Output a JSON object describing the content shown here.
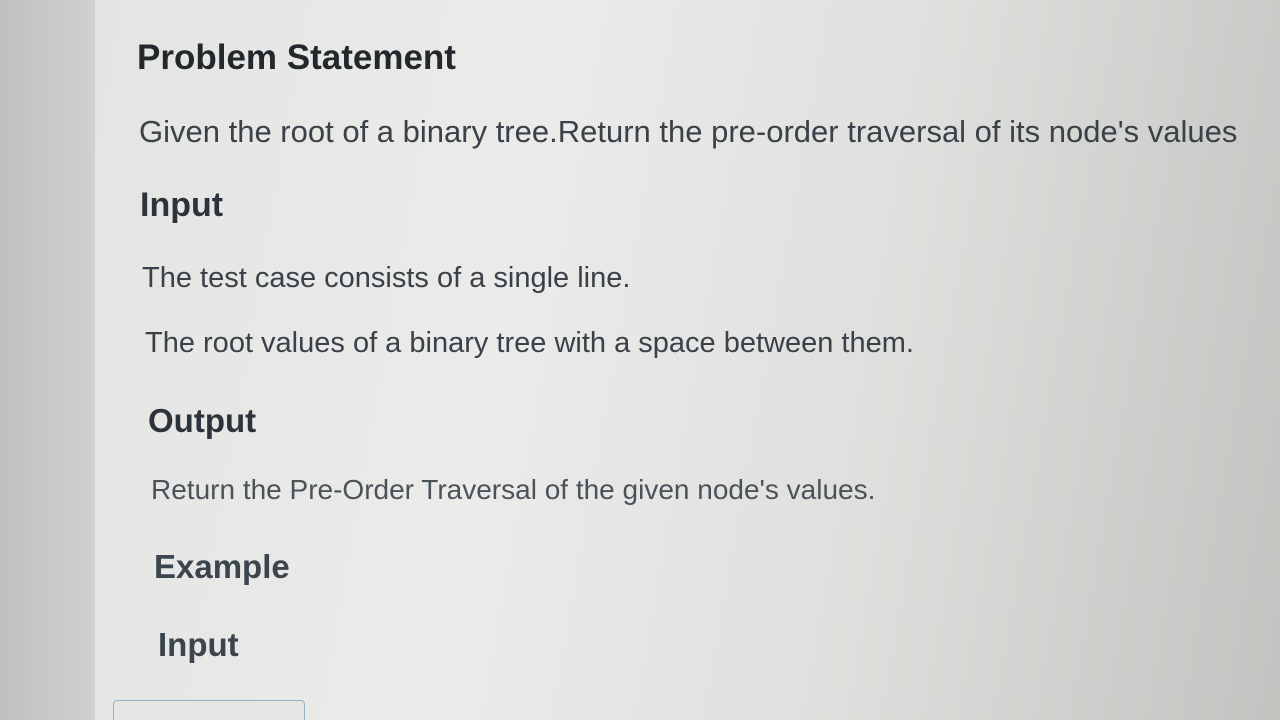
{
  "problem": {
    "heading": "Problem Statement",
    "description": "Given the root of a binary tree.Return the pre-order traversal of its node's values"
  },
  "input": {
    "heading": "Input",
    "lines": [
      "The test case consists of a single line.",
      "The root values of a binary tree with a space between them."
    ]
  },
  "output": {
    "heading": "Output",
    "description": "Return the Pre-Order Traversal of the given node's values."
  },
  "example": {
    "heading": "Example",
    "input_heading": "Input"
  }
}
